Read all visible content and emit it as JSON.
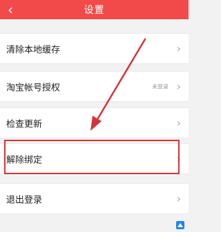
{
  "header": {
    "title": "设置",
    "back_glyph": "‹",
    "background": "#f24a4a"
  },
  "rows": [
    {
      "label": "清除本地缓存",
      "status": "",
      "chevron": "›"
    },
    {
      "label": "淘宝帐号授权",
      "status": "未登录",
      "chevron": "›"
    },
    {
      "label": "检查更新",
      "status": "",
      "chevron": "›"
    },
    {
      "label": "解除绑定",
      "status": "",
      "chevron": "›"
    },
    {
      "label": "退出登录",
      "status": "",
      "chevron": "›"
    }
  ],
  "annotation": {
    "highlight_color": "#d2343a",
    "arrow_color": "#d2343a"
  },
  "watermark": {
    "text": "",
    "icon": "watermark-logo-icon"
  }
}
